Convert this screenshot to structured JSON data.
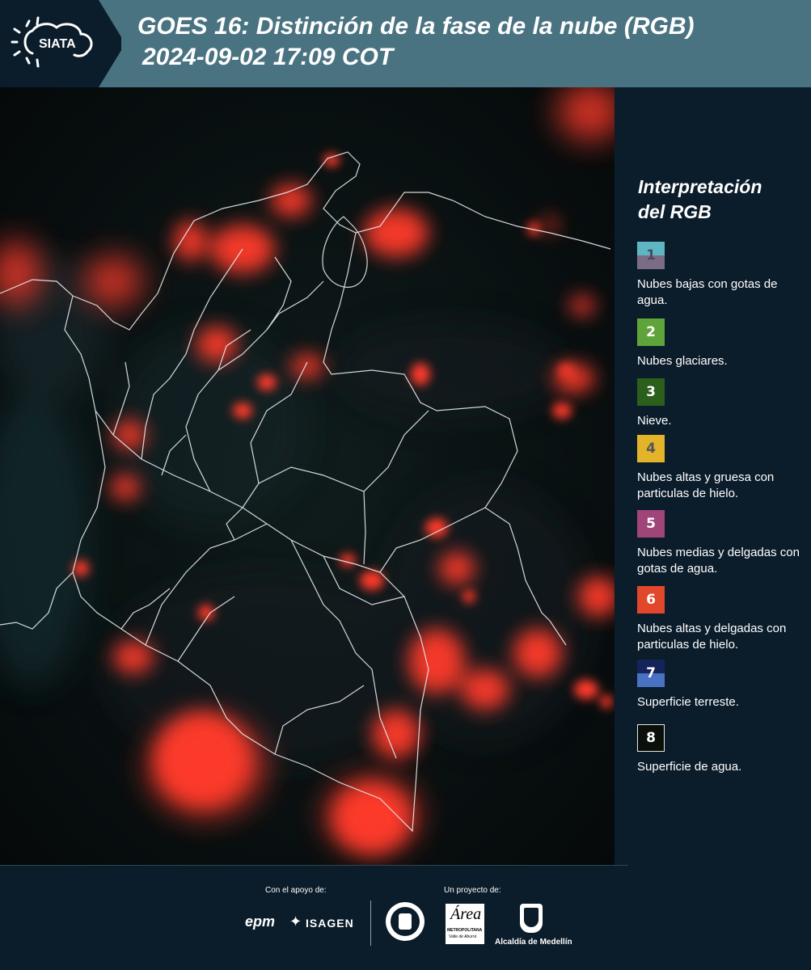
{
  "header": {
    "logo_text": "SIATA",
    "title_line1": "GOES 16: Distinción de la fase de la nube (RGB)",
    "title_line2": "2024-09-02 17:09 COT"
  },
  "map": {
    "description_icon": "satellite-rgb-map"
  },
  "legend": {
    "title_line1": "Interpretación",
    "title_line2": "del RGB",
    "items": [
      {
        "number": "1",
        "label": "Nubes bajas con gotas de agua.",
        "color_top": "#5fb6c3",
        "color_bottom": "#7a6c86",
        "text_color": "#4a4a5a"
      },
      {
        "number": "2",
        "label": "Nubes glaciares.",
        "color_top": "#5ea43a",
        "color_bottom": "#5ea43a",
        "text_color": "#ffffff"
      },
      {
        "number": "3",
        "label": "Nieve.",
        "color_top": "#2c5e1c",
        "color_bottom": "#2c5e1c",
        "text_color": "#ffffff"
      },
      {
        "number": "4",
        "label": "Nubes altas y gruesa con particulas de hielo.",
        "color_top": "#e3b32a",
        "color_bottom": "#e3b32a",
        "text_color": "#555555"
      },
      {
        "number": "5",
        "label": "Nubes medias y delgadas con gotas de agua.",
        "color_top": "#a0457a",
        "color_bottom": "#a0457a",
        "text_color": "#ffffff"
      },
      {
        "number": "6",
        "label": "Nubes altas y delgadas con particulas de hielo.",
        "color_top": "#e2472b",
        "color_bottom": "#e2472b",
        "text_color": "#ffffff"
      },
      {
        "number": "7",
        "label": "Superficie terreste.",
        "color_top": "#14235a",
        "color_bottom": "#4a72c2",
        "text_color": "#ffffff"
      },
      {
        "number": "8",
        "label": "Superficie de agua.",
        "color_top": "#0a0f0a",
        "color_bottom": "#0a0f0a",
        "text_color": "#ffffff"
      }
    ]
  },
  "footer": {
    "support_label": "Con el apoyo de:",
    "project_label": "Un proyecto de:",
    "sponsor_epm": "epm",
    "sponsor_isagen": "ISAGEN",
    "amva_name": "Área",
    "amva_sub1": "METROPOLITANA",
    "amva_sub2": "Valle de Aburrá",
    "alcaldia": "Alcaldía de Medellín"
  },
  "colors": {
    "header_bg": "#4a7382",
    "page_bg": "#0b1c2a",
    "cloud_red": "#ff3a2a"
  }
}
